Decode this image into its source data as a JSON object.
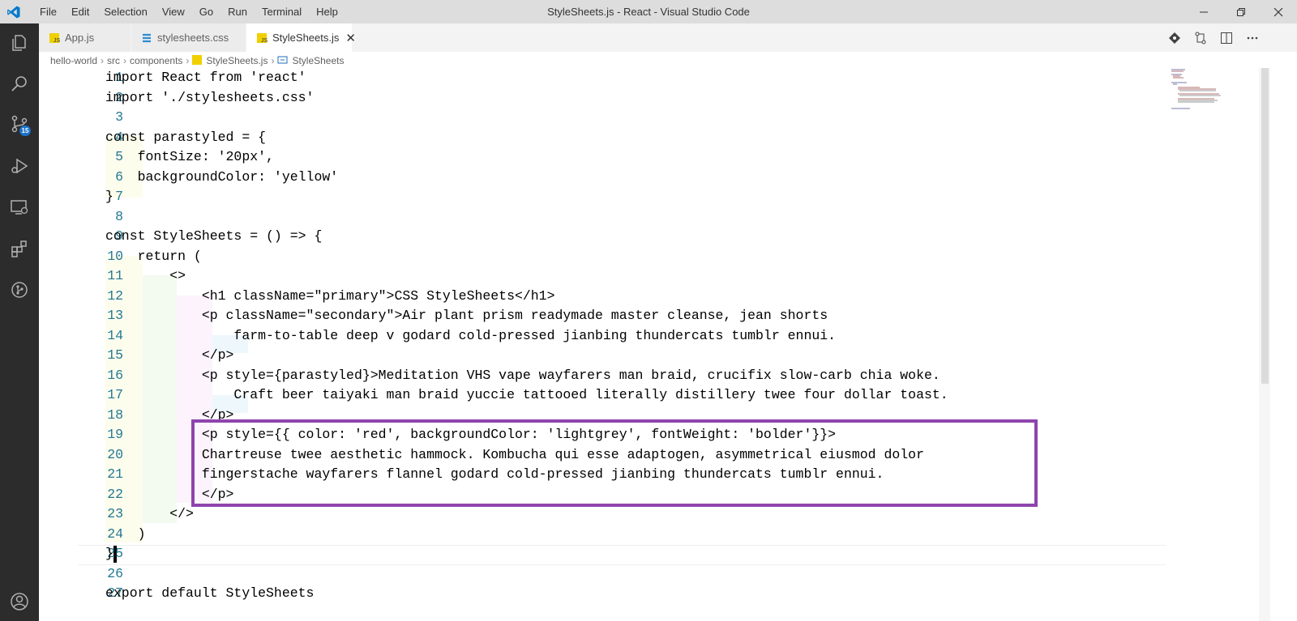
{
  "window": {
    "title": "StyleSheets.js - React - Visual Studio Code",
    "menu": [
      "File",
      "Edit",
      "Selection",
      "View",
      "Go",
      "Run",
      "Terminal",
      "Help"
    ]
  },
  "activity_bar": {
    "items": [
      "explorer-icon",
      "search-icon",
      "source-control-icon",
      "run-debug-icon",
      "remote-explorer-icon",
      "extensions-icon",
      "git-graph-icon",
      "account-icon"
    ],
    "source_control_badge": "15"
  },
  "tabs": [
    {
      "label": "App.js",
      "icon": "js-file-icon",
      "active": false
    },
    {
      "label": "stylesheets.css",
      "icon": "css-file-icon",
      "active": false
    },
    {
      "label": "StyleSheets.js",
      "icon": "js-file-icon",
      "active": true
    }
  ],
  "breadcrumb": [
    "hello-world",
    "src",
    "components",
    "StyleSheets.js",
    "StyleSheets"
  ],
  "editor": {
    "line_numbers": [
      "1",
      "2",
      "3",
      "4",
      "5",
      "6",
      "7",
      "8",
      "9",
      "10",
      "11",
      "12",
      "13",
      "14",
      "15",
      "16",
      "17",
      "18",
      "19",
      "20",
      "21",
      "22",
      "23",
      "24",
      "25",
      "26",
      "27"
    ],
    "lines": [
      "import React from 'react'",
      "import './stylesheets.css'",
      "",
      "const parastyled = {",
      "    fontSize: '20px',",
      "    backgroundColor: 'yellow'",
      "}",
      "",
      "const StyleSheets = () => {",
      "    return (",
      "        <>",
      "            <h1 className=\"primary\">CSS StyleSheets</h1>",
      "            <p className=\"secondary\">Air plant prism readymade master cleanse, jean shorts",
      "                farm-to-table deep v godard cold-pressed jianbing thundercats tumblr ennui.",
      "            </p>",
      "            <p style={parastyled}>Meditation VHS vape wayfarers man braid, crucifix slow-carb chia woke.",
      "                Craft beer taiyaki man braid yuccie tattooed literally distillery twee four dollar toast.",
      "            </p>",
      "            <p style={{ color: 'red', backgroundColor: 'lightgrey', fontWeight: 'bolder'}}>",
      "            Chartreuse twee aesthetic hammock. Kombucha qui esse adaptogen, asymmetrical eiusmod dolor",
      "            fingerstache wayfarers flannel godard cold-pressed jianbing thundercats tumblr ennui.",
      "            </p>",
      "        </>",
      "    )",
      "}",
      "",
      "export default StyleSheets"
    ]
  },
  "colors": {
    "highlight_box": "#8e44ad",
    "activity_bar": "#2c2c2c",
    "title_bar": "#dddddd"
  }
}
